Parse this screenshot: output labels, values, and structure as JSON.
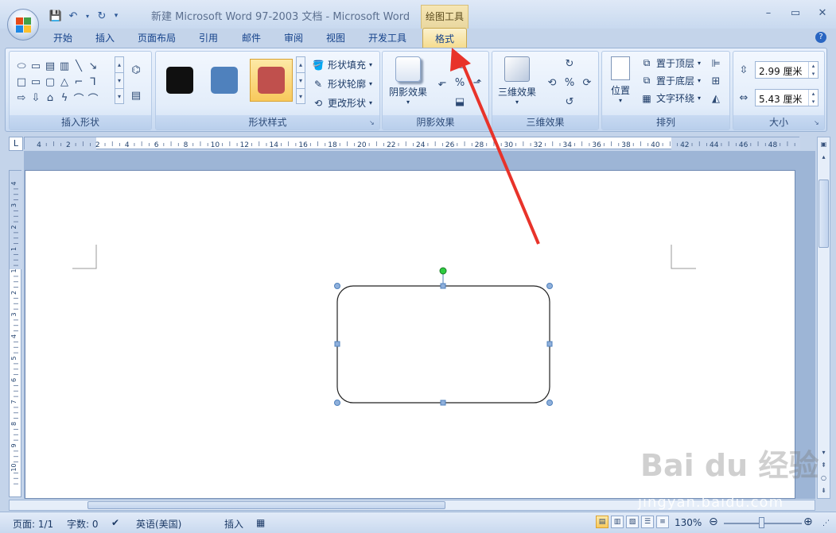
{
  "titlebar": {
    "title": "新建 Microsoft Word 97-2003 文档 - Microsoft Word",
    "context_tab": "绘图工具"
  },
  "tabs": [
    "开始",
    "插入",
    "页面布局",
    "引用",
    "邮件",
    "审阅",
    "视图",
    "开发工具",
    "格式"
  ],
  "active_tab": "格式",
  "groups": {
    "insert_shapes": {
      "label": "插入形状"
    },
    "shape_styles": {
      "label": "形状样式",
      "swatch_colors": [
        "#101010",
        "#4f81bd",
        "#c0504d"
      ],
      "fill": "形状填充",
      "outline": "形状轮廓",
      "change": "更改形状"
    },
    "shadow": {
      "label": "阴影效果",
      "button": "阴影效果"
    },
    "three_d": {
      "label": "三维效果",
      "button": "三维效果"
    },
    "arrange": {
      "label": "排列",
      "position": "位置",
      "bring_front": "置于顶层",
      "send_back": "置于底层",
      "text_wrap": "文字环绕"
    },
    "size": {
      "label": "大小",
      "height": "2.99 厘米",
      "width": "5.43 厘米"
    }
  },
  "ruler_h_labels": [
    "4",
    "2",
    "2",
    "4",
    "6",
    "8",
    "10",
    "12",
    "14",
    "16",
    "18",
    "20",
    "22",
    "24",
    "26",
    "28",
    "30",
    "32",
    "34",
    "36",
    "38",
    "40",
    "42",
    "44",
    "46",
    "48"
  ],
  "ruler_v_labels": [
    "4",
    "3",
    "2",
    "1",
    "1",
    "2",
    "3",
    "4",
    "5",
    "6",
    "7",
    "8",
    "9",
    "10"
  ],
  "statusbar": {
    "page": "页面: 1/1",
    "words": "字数: 0",
    "language": "英语(美国)",
    "mode": "插入",
    "zoom": "130%"
  },
  "watermark": {
    "text": "Bai du 经验",
    "url": "jingyan.baidu.com"
  },
  "colors": {
    "annotation_arrow": "#e8332a",
    "rotate_handle": "#2ecc40",
    "handle": "#4f81bd"
  }
}
